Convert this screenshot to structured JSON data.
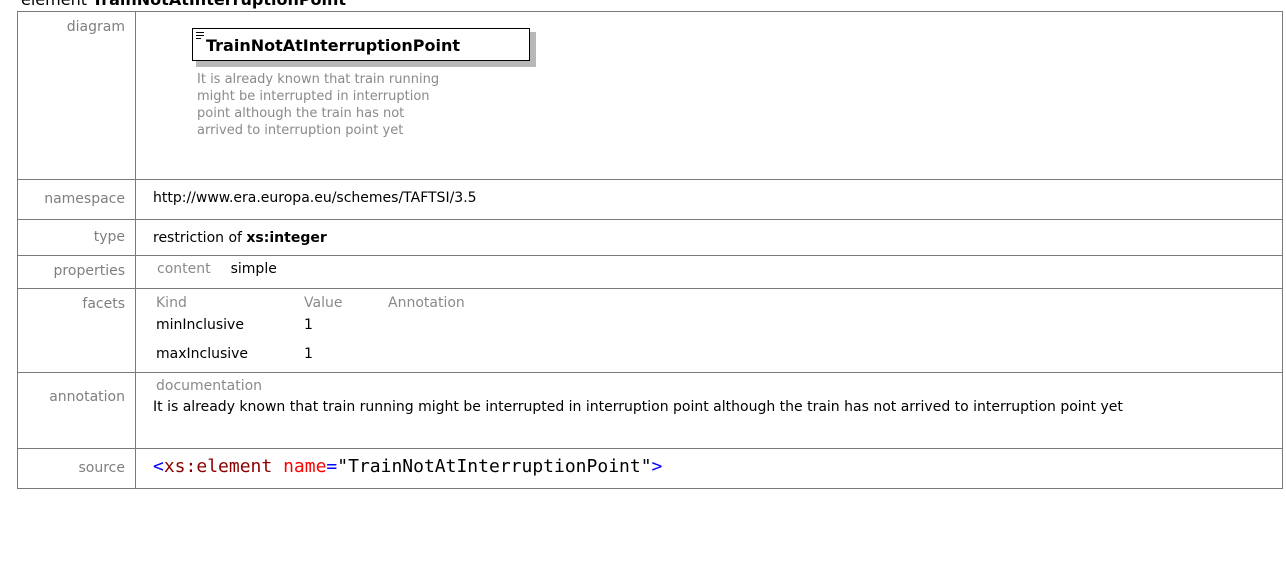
{
  "heading": {
    "prefix": "element ",
    "name": "TrainNotAtInterruptionPoint"
  },
  "rows": {
    "diagram": {
      "label": "diagram",
      "box_title": "TrainNotAtInterruptionPoint",
      "doc_text": "It is already known that train running\nmight be interrupted in interruption\npoint although the train has not\narrived to interruption point yet"
    },
    "namespace": {
      "label": "namespace",
      "value": "http://www.era.europa.eu/schemes/TAFTSI/3.5"
    },
    "type": {
      "label": "type",
      "prefix": "restriction of ",
      "base": "xs:integer"
    },
    "properties": {
      "label": "properties",
      "key": "content",
      "value": "simple"
    },
    "facets": {
      "label": "facets",
      "headers": [
        "Kind",
        "Value",
        "Annotation"
      ],
      "items": [
        {
          "kind": "minInclusive",
          "value": "1",
          "annotation": ""
        },
        {
          "kind": "maxInclusive",
          "value": "1",
          "annotation": ""
        }
      ]
    },
    "annotation": {
      "label": "annotation",
      "heading": "documentation",
      "text": "It is already known that train running might be interrupted in interruption point although the train has not arrived to interruption point yet"
    },
    "source": {
      "label": "source",
      "open_bracket": "<",
      "tag": "xs:element",
      "attr": "name",
      "eq": "=",
      "value": "\"TrainNotAtInterruptionPoint\"",
      "close_bracket": ">"
    }
  },
  "colors": {
    "label_gray": "#7f7f7f",
    "border": "#7a7a7a",
    "xml_bracket": "#0000ff",
    "xml_tag": "#8b0000",
    "xml_attr": "#ff0000"
  }
}
